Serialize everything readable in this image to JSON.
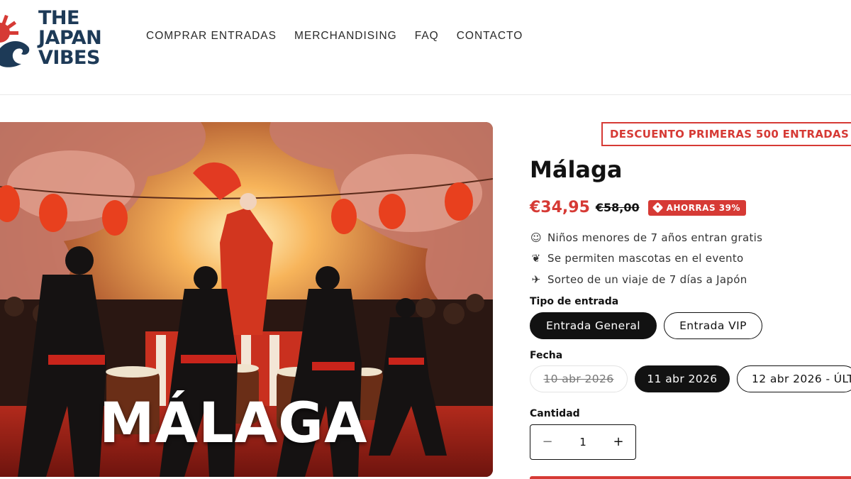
{
  "brand": {
    "line1": "THE",
    "line2": "JAPAN",
    "line3": "VIBES"
  },
  "nav": {
    "items": [
      {
        "label": "COMPRAR ENTRADAS"
      },
      {
        "label": "MERCHANDISING"
      },
      {
        "label": "FAQ"
      },
      {
        "label": "CONTACTO"
      }
    ]
  },
  "hero": {
    "overlay_text": "MÁLAGA"
  },
  "product": {
    "discount_banner": "DESCUENTO PRIMERAS 500 ENTRADAS",
    "title": "Málaga",
    "price": "€34,95",
    "compare_price": "€58,00",
    "savings": "AHORRAS 39%",
    "features": [
      {
        "icon": "child-emoji-icon",
        "text": "Niños menores de 7 años entran gratis"
      },
      {
        "icon": "dog-emoji-icon",
        "text": "Se permiten mascotas en el evento"
      },
      {
        "icon": "airplane-emoji-icon",
        "text": "Sorteo de un viaje de 7 días a Japón"
      }
    ],
    "ticket_type": {
      "label": "Tipo de entrada",
      "options": [
        "Entrada General",
        "Entrada VIP"
      ],
      "selected": "Entrada General"
    },
    "date": {
      "label": "Fecha",
      "options": [
        "10 abr 2026",
        "11 abr 2026",
        "12 abr 2026 - ÚLT"
      ],
      "selected": "11 abr 2026",
      "disabled": [
        "10 abr 2026"
      ]
    },
    "quantity": {
      "label": "Cantidad",
      "value": "1",
      "minus": "−",
      "plus": "+"
    }
  },
  "colors": {
    "accent": "#d63a35",
    "dark": "#121212",
    "brand_blue": "#1d3a57"
  }
}
